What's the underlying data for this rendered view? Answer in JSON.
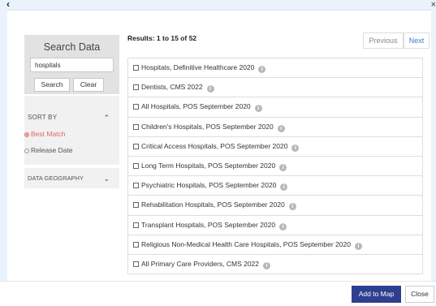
{
  "header": {
    "back_icon": "chevron-left-icon",
    "close_label": "×"
  },
  "search": {
    "title": "Search Data",
    "query": "hospitals",
    "search_label": "Search",
    "clear_label": "Clear"
  },
  "sort": {
    "label": "SORT BY",
    "options": [
      {
        "label": "Best Match",
        "selected": true
      },
      {
        "label": "Release Date",
        "selected": false
      }
    ]
  },
  "geography": {
    "label": "DATA GEOGRAPHY"
  },
  "results": {
    "summary": "Results: 1 to 15 of 52",
    "previous_label": "Previous",
    "next_label": "Next",
    "items": [
      "Hospitals, Definitive Healthcare 2020",
      "Dentists, CMS 2022",
      "All Hospitals, POS September 2020",
      "Children's Hospitals, POS September 2020",
      "Critical Access Hospitals, POS September 2020",
      "Long Term Hospitals, POS September 2020",
      "Psychiatric Hospitals, POS September 2020",
      "Rehabilitation Hospitals, POS September 2020",
      "Transplant Hospitals, POS September 2020",
      "Religious Non-Medical Health Care Hospitals, POS September 2020",
      "All Primary Care Providers, CMS 2022"
    ],
    "info_glyph": "i"
  },
  "footer": {
    "add_label": "Add to Map",
    "close_label": "Close"
  },
  "colors": {
    "accent": "#2f3f8f",
    "selected_radio": "#e06666",
    "link": "#3a7bd5"
  }
}
